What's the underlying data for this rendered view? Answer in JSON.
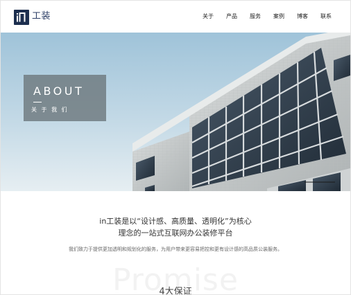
{
  "header": {
    "logo_text": "工装",
    "nav": [
      "关于",
      "产品",
      "服务",
      "案例",
      "博客",
      "联系"
    ]
  },
  "hero": {
    "about_title": "ABOUT",
    "about_sub": "关 于 我 们"
  },
  "content": {
    "headline_1": "in工装是以“设计感、高质量、透明化”为核心",
    "headline_2": "理念的一站式互联网办公装修平台",
    "description": "我们致力于提供更加透明和规划化的服务，为用户带来更容易把控和更有设计感的高品质公装服务。",
    "watermark": "Promise",
    "section_title": "4大保证"
  },
  "colors": {
    "brand": "#1d2f4f",
    "about_box": "#6e797e"
  }
}
